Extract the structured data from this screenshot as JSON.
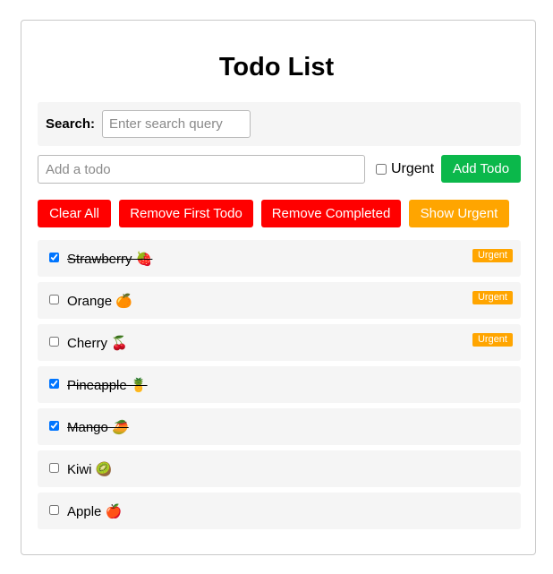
{
  "title": "Todo List",
  "search": {
    "label": "Search:",
    "placeholder": "Enter search query",
    "value": ""
  },
  "new_todo": {
    "placeholder": "Add a todo",
    "value": "",
    "urgent_label": "Urgent",
    "urgent_checked": false,
    "add_label": "Add Todo"
  },
  "actions": {
    "clear_all": "Clear All",
    "remove_first": "Remove First Todo",
    "remove_completed": "Remove Completed",
    "show_urgent": "Show Urgent"
  },
  "colors": {
    "green": "#0bb84b",
    "red": "#ff0000",
    "orange": "#ffa500",
    "row_bg": "#f5f5f5"
  },
  "todos": [
    {
      "text": "Strawberry 🍓",
      "completed": true,
      "urgent": true,
      "badge": "Urgent"
    },
    {
      "text": "Orange 🍊",
      "completed": false,
      "urgent": true,
      "badge": "Urgent"
    },
    {
      "text": "Cherry 🍒",
      "completed": false,
      "urgent": true,
      "badge": "Urgent"
    },
    {
      "text": "Pineapple 🍍",
      "completed": true,
      "urgent": false,
      "badge": ""
    },
    {
      "text": "Mango 🥭",
      "completed": true,
      "urgent": false,
      "badge": ""
    },
    {
      "text": "Kiwi 🥝",
      "completed": false,
      "urgent": false,
      "badge": ""
    },
    {
      "text": "Apple 🍎",
      "completed": false,
      "urgent": false,
      "badge": ""
    }
  ]
}
